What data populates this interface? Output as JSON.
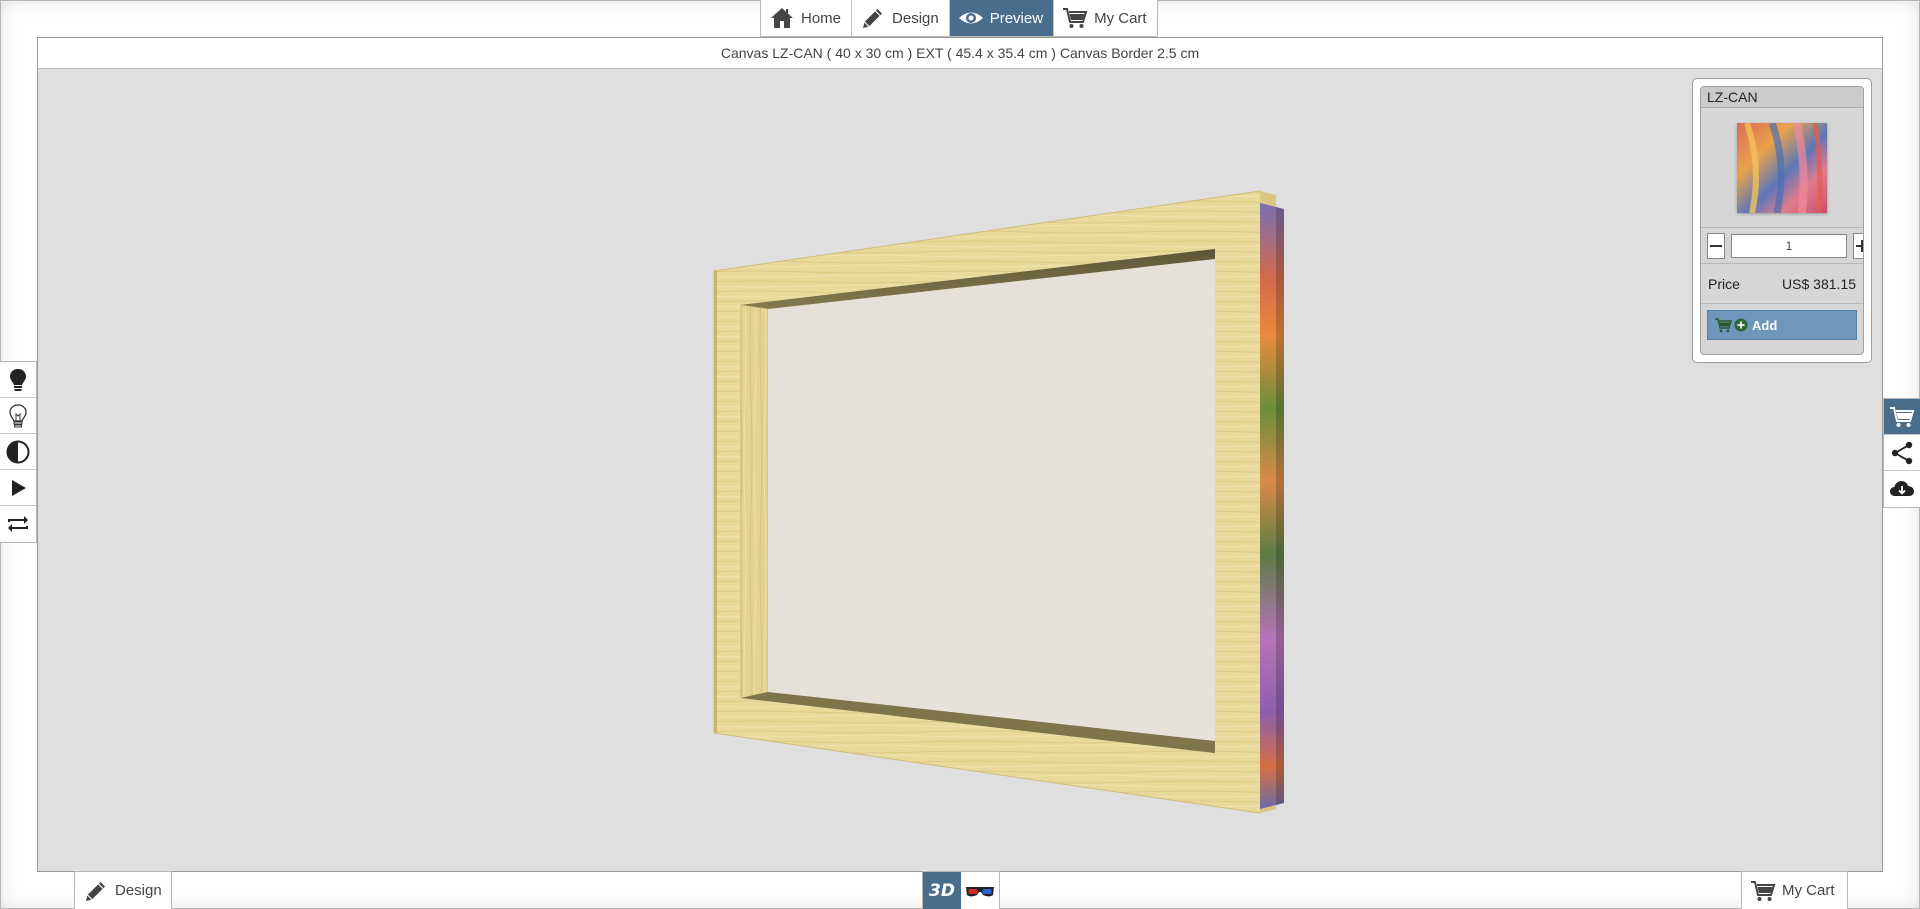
{
  "nav": {
    "home": "Home",
    "design": "Design",
    "preview": "Preview",
    "cart": "My Cart"
  },
  "viewport": {
    "title": "Canvas LZ-CAN ( 40 x 30 cm ) EXT ( 45.4 x 35.4 cm ) Canvas Border 2.5 cm"
  },
  "cart_panel": {
    "product_code": "LZ-CAN",
    "quantity": "1",
    "price_label": "Price",
    "price_value": "US$ 381.15",
    "add_label": "Add"
  },
  "bottom": {
    "design_label": "Design",
    "view_3d_label": "3D",
    "cart_label": "My Cart"
  },
  "colors": {
    "accent": "#4a6d8c",
    "add_button": "#6f97bb",
    "viewport_bg": "#dfdfdf",
    "frame_wood": "#e8d99a"
  },
  "icons": {
    "home": "home-icon",
    "design": "pencil-icon",
    "preview": "eye-icon",
    "cart": "cart-icon",
    "light_on": "bulb-filled-icon",
    "light_off": "bulb-outline-icon",
    "contrast": "contrast-icon",
    "play": "play-icon",
    "rotate": "rotate-icon",
    "share": "share-icon",
    "cloud": "cloud-download-icon",
    "glasses": "3d-glasses-icon"
  }
}
